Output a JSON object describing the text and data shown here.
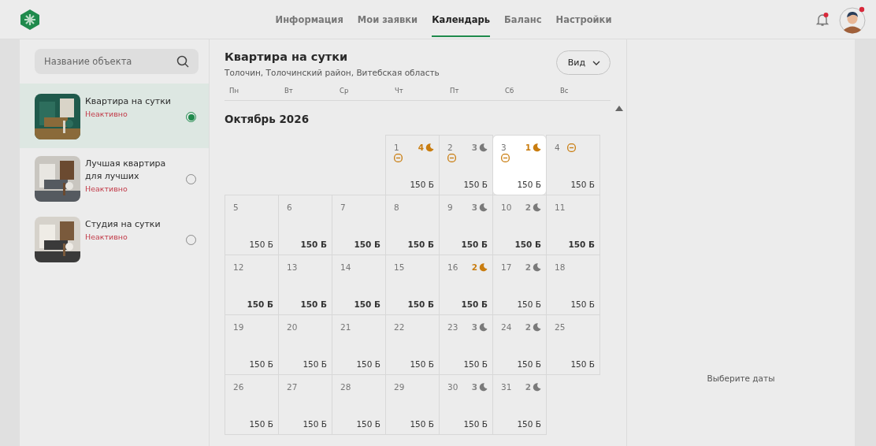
{
  "nav": {
    "tabs": [
      {
        "label": "Информация",
        "selected": false
      },
      {
        "label": "Мои заявки",
        "selected": false
      },
      {
        "label": "Календарь",
        "selected": true
      },
      {
        "label": "Баланс",
        "selected": false
      },
      {
        "label": "Настройки",
        "selected": false
      }
    ],
    "bell_unread": true,
    "avatar_unread": true
  },
  "sidebar": {
    "search": {
      "placeholder": "Название объекта"
    },
    "items": [
      {
        "title": "Квартира на сутки",
        "status": "Неактивно",
        "selected": true
      },
      {
        "title": "Лучшая квартира для лучших",
        "status": "Неактивно",
        "selected": false
      },
      {
        "title": "Студия на сутки",
        "status": "Неактивно",
        "selected": false
      }
    ]
  },
  "calendar": {
    "title": "Квартира на сутки",
    "address": "Толочин, Толочинский район, Витебская область",
    "view_button": "Вид",
    "weekdays": [
      "Пн",
      "Вт",
      "Ср",
      "Чт",
      "Пт",
      "Сб",
      "Вс"
    ],
    "month": "Октябрь 2026",
    "days": [
      {
        "day": "1",
        "nights": "4",
        "nights_accent": true,
        "blocked": true,
        "price": "150 Б",
        "bold": false,
        "selected": false
      },
      {
        "day": "2",
        "nights": "3",
        "nights_accent": false,
        "blocked": true,
        "price": "150 Б",
        "bold": false,
        "selected": false
      },
      {
        "day": "3",
        "nights": "1",
        "nights_accent": true,
        "blocked": true,
        "price": "150 Б",
        "bold": false,
        "selected": true
      },
      {
        "day": "4",
        "blocked": true,
        "price": "150 Б",
        "bold": false,
        "selected": false
      },
      {
        "day": "5",
        "blocked": false,
        "price": "150 Б",
        "bold": false,
        "selected": false
      },
      {
        "day": "6",
        "blocked": false,
        "price": "150 Б",
        "bold": true,
        "selected": false
      },
      {
        "day": "7",
        "blocked": false,
        "price": "150 Б",
        "bold": true,
        "selected": false
      },
      {
        "day": "8",
        "blocked": false,
        "price": "150 Б",
        "bold": true,
        "selected": false
      },
      {
        "day": "9",
        "nights": "3",
        "nights_accent": false,
        "blocked": false,
        "price": "150 Б",
        "bold": true,
        "selected": false
      },
      {
        "day": "10",
        "nights": "2",
        "nights_accent": false,
        "blocked": false,
        "price": "150 Б",
        "bold": true,
        "selected": false
      },
      {
        "day": "11",
        "blocked": false,
        "price": "150 Б",
        "bold": true,
        "selected": false
      },
      {
        "day": "12",
        "blocked": false,
        "price": "150 Б",
        "bold": true,
        "selected": false
      },
      {
        "day": "13",
        "blocked": false,
        "price": "150 Б",
        "bold": true,
        "selected": false
      },
      {
        "day": "14",
        "blocked": false,
        "price": "150 Б",
        "bold": true,
        "selected": false
      },
      {
        "day": "15",
        "blocked": false,
        "price": "150 Б",
        "bold": true,
        "selected": false
      },
      {
        "day": "16",
        "nights": "2",
        "nights_accent": true,
        "blocked": false,
        "price": "150 Б",
        "bold": true,
        "selected": false
      },
      {
        "day": "17",
        "nights": "2",
        "nights_accent": false,
        "blocked": false,
        "price": "150 Б",
        "bold": false,
        "selected": false
      },
      {
        "day": "18",
        "blocked": false,
        "price": "150 Б",
        "bold": false,
        "selected": false
      },
      {
        "day": "19",
        "blocked": false,
        "price": "150 Б",
        "bold": false,
        "selected": false
      },
      {
        "day": "20",
        "blocked": false,
        "price": "150 Б",
        "bold": false,
        "selected": false
      },
      {
        "day": "21",
        "blocked": false,
        "price": "150 Б",
        "bold": false,
        "selected": false
      },
      {
        "day": "22",
        "blocked": false,
        "price": "150 Б",
        "bold": false,
        "selected": false
      },
      {
        "day": "23",
        "nights": "3",
        "nights_accent": false,
        "blocked": false,
        "price": "150 Б",
        "bold": false,
        "selected": false
      },
      {
        "day": "24",
        "nights": "2",
        "nights_accent": false,
        "blocked": false,
        "price": "150 Б",
        "bold": false,
        "selected": false
      },
      {
        "day": "25",
        "blocked": false,
        "price": "150 Б",
        "bold": false,
        "selected": false
      },
      {
        "day": "26",
        "blocked": false,
        "price": "150 Б",
        "bold": false,
        "selected": false
      },
      {
        "day": "27",
        "blocked": false,
        "price": "150 Б",
        "bold": false,
        "selected": false
      },
      {
        "day": "28",
        "blocked": false,
        "price": "150 Б",
        "bold": false,
        "selected": false
      },
      {
        "day": "29",
        "blocked": false,
        "price": "150 Б",
        "bold": false,
        "selected": false
      },
      {
        "day": "30",
        "nights": "3",
        "nights_accent": false,
        "blocked": false,
        "price": "150 Б",
        "bold": false,
        "selected": false
      },
      {
        "day": "31",
        "nights": "2",
        "nights_accent": false,
        "blocked": false,
        "price": "150 Б",
        "bold": false,
        "selected": false
      }
    ]
  },
  "details": {
    "hint": "Выберите даты"
  }
}
